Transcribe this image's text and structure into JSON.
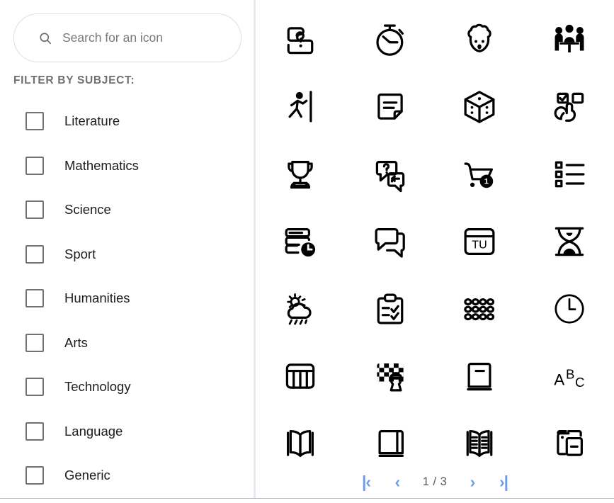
{
  "search": {
    "placeholder": "Search for an icon",
    "value": "",
    "icon": "search-icon"
  },
  "filter": {
    "heading": "FILTER BY SUBJECT:",
    "items": [
      {
        "label": "Literature",
        "checked": false
      },
      {
        "label": "Mathematics",
        "checked": false
      },
      {
        "label": "Science",
        "checked": false
      },
      {
        "label": "Sport",
        "checked": false
      },
      {
        "label": "Humanities",
        "checked": false
      },
      {
        "label": "Arts",
        "checked": false
      },
      {
        "label": "Technology",
        "checked": false
      },
      {
        "label": "Language",
        "checked": false
      },
      {
        "label": "Generic",
        "checked": false
      }
    ]
  },
  "icon_grid": {
    "columns": 4,
    "rows": 7,
    "icons": [
      {
        "name": "puzzle-piece-question-icon",
        "row": 1,
        "col": 1
      },
      {
        "name": "stopwatch-icon",
        "row": 1,
        "col": 2
      },
      {
        "name": "brain-head-icon",
        "row": 1,
        "col": 3
      },
      {
        "name": "group-meeting-table-icon",
        "row": 1,
        "col": 4
      },
      {
        "name": "runner-finish-line-icon",
        "row": 2,
        "col": 1
      },
      {
        "name": "note-document-icon",
        "row": 2,
        "col": 2
      },
      {
        "name": "dice-icon",
        "row": 2,
        "col": 3
      },
      {
        "name": "multiple-choice-click-icon",
        "row": 2,
        "col": 4
      },
      {
        "name": "trophy-icon",
        "row": 3,
        "col": 1
      },
      {
        "name": "question-answer-chat-icon",
        "row": 3,
        "col": 2
      },
      {
        "name": "shopping-cart-badge-icon",
        "row": 3,
        "col": 3,
        "badge": "1"
      },
      {
        "name": "bullet-list-icon",
        "row": 3,
        "col": 4
      },
      {
        "name": "schedule-clock-icon",
        "row": 4,
        "col": 1
      },
      {
        "name": "chat-bubbles-icon",
        "row": 4,
        "col": 2
      },
      {
        "name": "calendar-day-icon",
        "row": 4,
        "col": 3,
        "text": "TU"
      },
      {
        "name": "hourglass-icon",
        "row": 4,
        "col": 4
      },
      {
        "name": "weather-sun-cloud-rain-icon",
        "row": 5,
        "col": 1
      },
      {
        "name": "clipboard-checklist-icon",
        "row": 5,
        "col": 2
      },
      {
        "name": "dot-grid-icon",
        "row": 5,
        "col": 3
      },
      {
        "name": "clock-icon",
        "row": 5,
        "col": 4
      },
      {
        "name": "table-columns-icon",
        "row": 6,
        "col": 1
      },
      {
        "name": "chess-board-piece-icon",
        "row": 6,
        "col": 2
      },
      {
        "name": "closed-book-icon",
        "row": 6,
        "col": 3
      },
      {
        "name": "abc-letters-icon",
        "row": 6,
        "col": 4,
        "text": "ABC"
      },
      {
        "name": "open-book-icon",
        "row": 7,
        "col": 1
      },
      {
        "name": "book-standing-icon",
        "row": 7,
        "col": 2
      },
      {
        "name": "open-book-lined-icon",
        "row": 7,
        "col": 3
      },
      {
        "name": "book-collection-icon",
        "row": 7,
        "col": 4
      }
    ]
  },
  "pagination": {
    "first_label": "|‹",
    "prev_label": "‹",
    "indicator": "1 / 3",
    "next_label": "›",
    "last_label": "›|",
    "current_page": 1,
    "total_pages": 3,
    "accent_color": "#6e9ceb"
  },
  "icon_badges": {
    "cart_badge": "1",
    "calendar_text": "TU",
    "abc_a": "A",
    "abc_b": "B",
    "abc_c": "C"
  }
}
